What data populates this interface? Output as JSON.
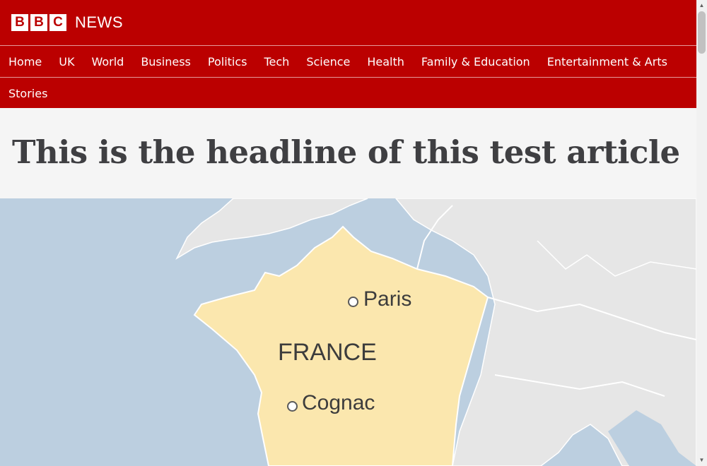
{
  "brand": {
    "logo_letters": [
      "B",
      "B",
      "C"
    ],
    "logo_text": "NEWS",
    "color": "#bb0000"
  },
  "nav": {
    "items_row1": [
      "Home",
      "UK",
      "World",
      "Business",
      "Politics",
      "Tech",
      "Science",
      "Health",
      "Family & Education",
      "Entertainment & Arts"
    ],
    "items_row2": [
      "Stories"
    ]
  },
  "article": {
    "headline": "This is the headline of this test article"
  },
  "map": {
    "labels": {
      "paris": "Paris",
      "france": "FRANCE",
      "cognac": "Cognac"
    },
    "colors": {
      "sea": "#bccfe0",
      "land_other": "#e6e6e6",
      "france": "#fbe7ae",
      "border": "#ffffff"
    }
  },
  "scrollbar": {
    "up_icon": "triangle-up-icon",
    "down_icon": "triangle-down-icon"
  }
}
